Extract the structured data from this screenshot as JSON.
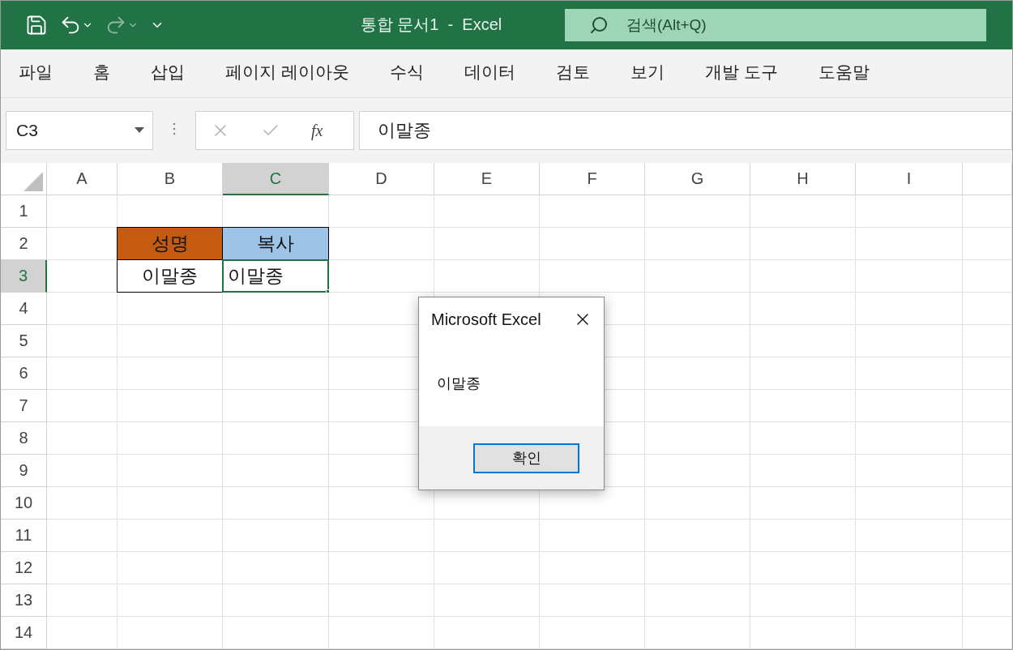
{
  "title_bar": {
    "title": "통합 문서1  -  Excel",
    "search": {
      "placeholder": "검색(Alt+Q)"
    }
  },
  "ribbon_tabs": [
    {
      "label": "파일",
      "selected": false
    },
    {
      "label": "홈",
      "selected": false
    },
    {
      "label": "삽입",
      "selected": false
    },
    {
      "label": "페이지 레이아웃",
      "selected": false
    },
    {
      "label": "수식",
      "selected": false
    },
    {
      "label": "데이터",
      "selected": false
    },
    {
      "label": "검토",
      "selected": false
    },
    {
      "label": "보기",
      "selected": false
    },
    {
      "label": "개발 도구",
      "selected": false
    },
    {
      "label": "도움말",
      "selected": false
    }
  ],
  "formula_bar": {
    "name_box": "C3",
    "function_label": "fx",
    "value": "이말종"
  },
  "sheet": {
    "columns": [
      {
        "label": "A",
        "selected": false
      },
      {
        "label": "B",
        "selected": false
      },
      {
        "label": "C",
        "selected": true
      },
      {
        "label": "D",
        "selected": false
      },
      {
        "label": "E",
        "selected": false
      },
      {
        "label": "F",
        "selected": false
      },
      {
        "label": "G",
        "selected": false
      },
      {
        "label": "H",
        "selected": false
      },
      {
        "label": "I",
        "selected": false
      }
    ],
    "rows": [
      {
        "label": "1",
        "selected": false
      },
      {
        "label": "2",
        "selected": false,
        "cells": [
          {},
          {
            "text": "성명",
            "color": "#c55a11",
            "bordered": true,
            "selected": false
          },
          {
            "text": "복사",
            "color": "#9dc3e6",
            "bordered": true,
            "selected": false
          }
        ]
      },
      {
        "label": "3",
        "selected": true,
        "cells": [
          {},
          {
            "text": "이말종",
            "bordered": true,
            "selected": false
          },
          {
            "text": "이말종",
            "bordered": true,
            "selected": true
          }
        ]
      },
      {
        "label": "4",
        "selected": false
      },
      {
        "label": "5",
        "selected": false
      },
      {
        "label": "6",
        "selected": false
      },
      {
        "label": "7",
        "selected": false
      },
      {
        "label": "8",
        "selected": false
      },
      {
        "label": "9",
        "selected": false
      },
      {
        "label": "10",
        "selected": false
      },
      {
        "label": "11",
        "selected": false
      },
      {
        "label": "12",
        "selected": false
      },
      {
        "label": "13",
        "selected": false
      },
      {
        "label": "14",
        "selected": false
      }
    ]
  },
  "dialog": {
    "title": "Microsoft Excel",
    "message": "이말종",
    "button": "확인"
  }
}
